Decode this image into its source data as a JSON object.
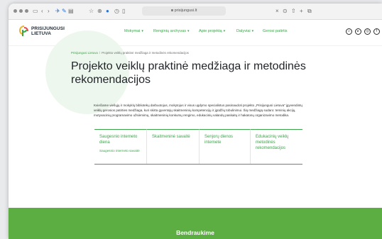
{
  "browser": {
    "url": "prisijungusi.lt"
  },
  "header": {
    "logo_line1": "PRISIJUNGUSI",
    "logo_line2": "LIETUVA",
    "nav": [
      "Mokymai",
      "Renginių archyvas",
      "Apie projektą",
      "Dalyviai",
      "Gerosi patirtis"
    ]
  },
  "breadcrumb": {
    "home": "Prisijungusi Lietuva",
    "separator": "/",
    "current": "Projekto veiklų praktinė medžiaga ir metodinės rekomendacijos"
  },
  "page": {
    "title": "Projekto veiklų praktinė medžiaga ir metodinės rekomendacijos",
    "intro": "Kviečiame viešųjų ir mokyklų bibliotekų darbuotojus, mokytojus ir visus ugdymo specialistus pasinaudoti projekto „Prisijungusi Lietuva“ įgyvendintų veiklų gerosios patirties medžiaga, kuri skirta gyventojų skaitmeninių kompetencijų ir įgūdžių tobulinimui. Šią medžiagą sudaro: teminių akcijų, motyvacinių programavimo užsiėmimų, skaitmeninių konkursų rengimo, edukacinių valandų paskaitų ir hakatonų organizavimo metodika."
  },
  "cards": [
    {
      "title": "Saugesnio interneto diena",
      "sub": "Saugesnio interneto savaitė"
    },
    {
      "title": "Skaitmeninė savaitė",
      "sub": ""
    },
    {
      "title": "Senjorų dienos internete",
      "sub": ""
    },
    {
      "title": "Edukacinių veiklų metodinės rekomendacijos",
      "sub": ""
    }
  ],
  "footer": {
    "title": "Bendraukime"
  },
  "colors": {
    "brand_green": "#3ba54a",
    "footer_green": "#5cad42"
  }
}
